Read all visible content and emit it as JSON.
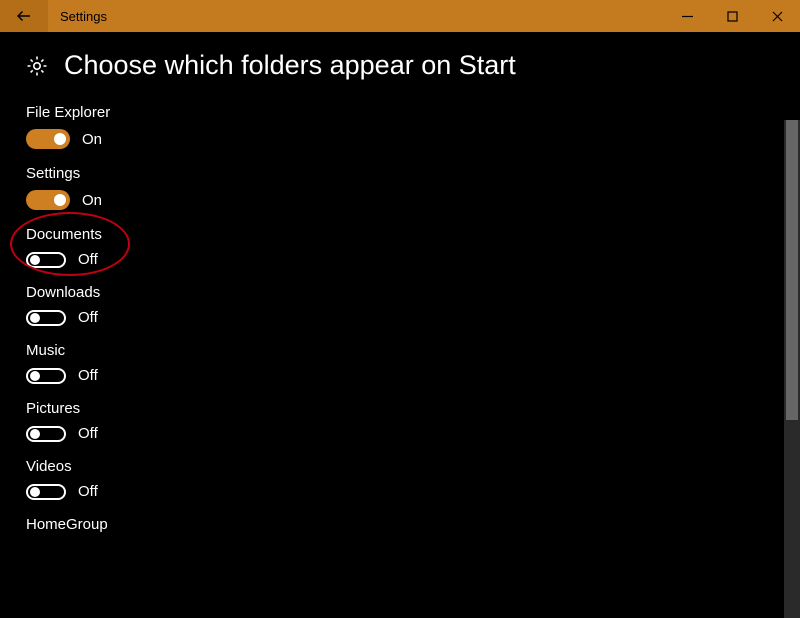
{
  "titlebar": {
    "title": "Settings"
  },
  "page": {
    "heading": "Choose which folders appear on Start",
    "on_label": "On",
    "off_label": "Off"
  },
  "items": [
    {
      "label": "File Explorer",
      "state": "on"
    },
    {
      "label": "Settings",
      "state": "on",
      "highlighted": true
    },
    {
      "label": "Documents",
      "state": "off"
    },
    {
      "label": "Downloads",
      "state": "off"
    },
    {
      "label": "Music",
      "state": "off"
    },
    {
      "label": "Pictures",
      "state": "off"
    },
    {
      "label": "Videos",
      "state": "off"
    }
  ],
  "cutoff_item_label": "HomeGroup",
  "colors": {
    "accent": "#cd7f21",
    "titlebar": "#c47a1f",
    "back_button": "#b46e17",
    "highlight_ring": "#c00010"
  }
}
